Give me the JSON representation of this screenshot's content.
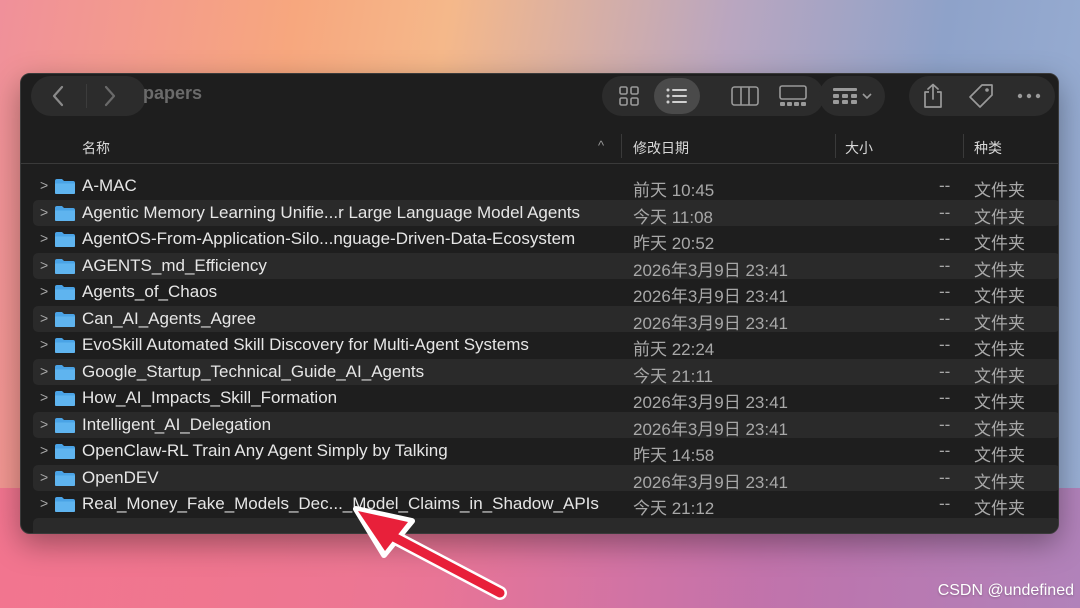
{
  "window": {
    "title": "papers"
  },
  "toolbar": {
    "icons": [
      "chevron-left-icon",
      "chevron-right-icon",
      "grid-view-icon",
      "list-view-icon",
      "column-view-icon",
      "gallery-view-icon",
      "group-icon",
      "share-icon",
      "tag-icon",
      "more-icon"
    ]
  },
  "columns": {
    "name": "名称",
    "date": "修改日期",
    "size": "大小",
    "kind": "种类"
  },
  "rows": [
    {
      "name": "A-MAC",
      "date": "前天 10:45",
      "size": "--",
      "kind": "文件夹"
    },
    {
      "name": "Agentic Memory Learning Unifie...r Large Language Model Agents",
      "date": "今天 11:08",
      "size": "--",
      "kind": "文件夹"
    },
    {
      "name": "AgentOS-From-Application-Silo...nguage-Driven-Data-Ecosystem",
      "date": "昨天 20:52",
      "size": "--",
      "kind": "文件夹"
    },
    {
      "name": "AGENTS_md_Efficiency",
      "date": "2026年3月9日 23:41",
      "size": "--",
      "kind": "文件夹"
    },
    {
      "name": "Agents_of_Chaos",
      "date": "2026年3月9日 23:41",
      "size": "--",
      "kind": "文件夹"
    },
    {
      "name": "Can_AI_Agents_Agree",
      "date": "2026年3月9日 23:41",
      "size": "--",
      "kind": "文件夹"
    },
    {
      "name": "EvoSkill Automated Skill Discovery for Multi-Agent Systems",
      "date": "前天 22:24",
      "size": "--",
      "kind": "文件夹"
    },
    {
      "name": "Google_Startup_Technical_Guide_AI_Agents",
      "date": "今天 21:11",
      "size": "--",
      "kind": "文件夹"
    },
    {
      "name": "How_AI_Impacts_Skill_Formation",
      "date": "2026年3月9日 23:41",
      "size": "--",
      "kind": "文件夹"
    },
    {
      "name": "Intelligent_AI_Delegation",
      "date": "2026年3月9日 23:41",
      "size": "--",
      "kind": "文件夹"
    },
    {
      "name": "OpenClaw-RL Train Any Agent Simply by Talking",
      "date": "昨天 14:58",
      "size": "--",
      "kind": "文件夹"
    },
    {
      "name": "OpenDEV",
      "date": "2026年3月9日 23:41",
      "size": "--",
      "kind": "文件夹"
    },
    {
      "name": "Real_Money_Fake_Models_Dec..._Model_Claims_in_Shadow_APIs",
      "date": "今天 21:12",
      "size": "--",
      "kind": "文件夹"
    }
  ],
  "watermark": "CSDN @undefined",
  "colors": {
    "folder": "#5fb4ef",
    "arrow": "#e8203a"
  }
}
